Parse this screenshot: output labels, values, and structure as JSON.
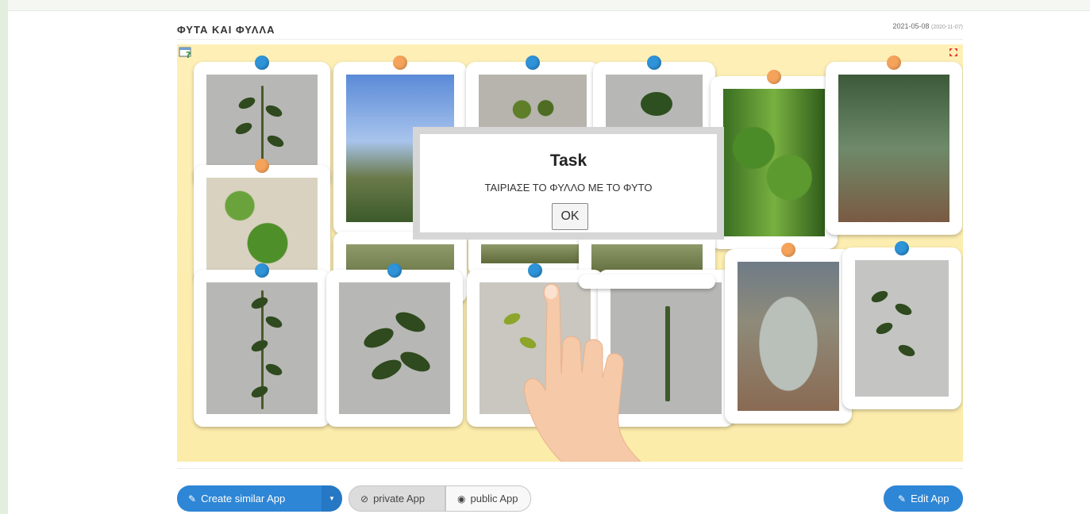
{
  "app": {
    "title": "ΦΥΤΑ ΚΑΙ ΦΥΛΛΑ",
    "date": "2021-05-08",
    "date_sub": "(2020-11-07)"
  },
  "task_dialog": {
    "title": "Task",
    "message": "ΤΑΙΡΙΑΣΕ ΤΟ ΦΥΛΛΟ ΜΕ ΤΟ ΦΥΤΟ",
    "ok_label": "OK"
  },
  "actions": {
    "create_label": "Create similar App",
    "private_label": "private App",
    "public_label": "public App",
    "edit_label": "Edit App"
  },
  "colors": {
    "accent": "#2e86d6",
    "board": "#fdeeb2",
    "pin_blue": "#2e93d8",
    "pin_orange": "#f5a35b"
  }
}
